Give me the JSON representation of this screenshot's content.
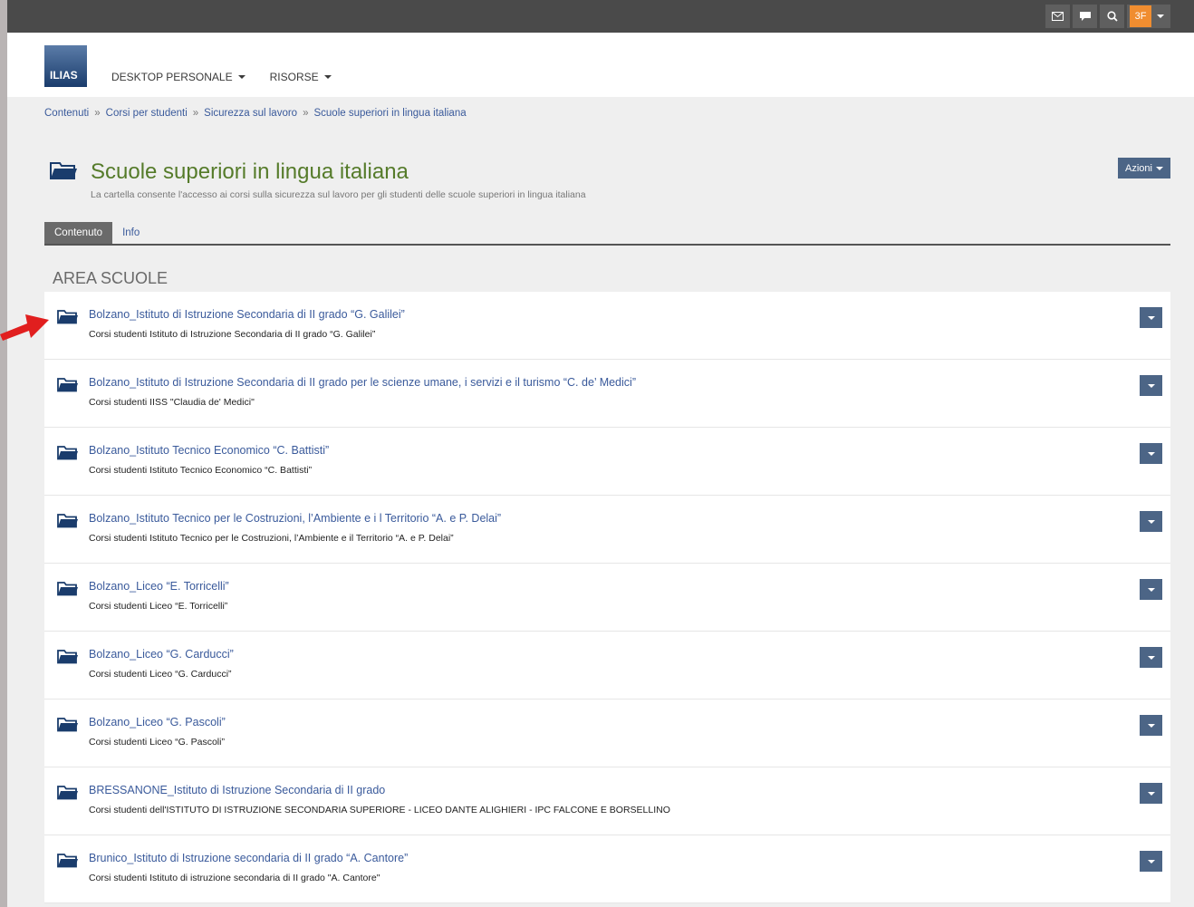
{
  "topbar": {
    "user_initials": "3F"
  },
  "header": {
    "logo_text": "ILIAS",
    "menu": [
      {
        "label": "DESKTOP PERSONALE"
      },
      {
        "label": "RISORSE"
      }
    ]
  },
  "breadcrumb": [
    "Contenuti",
    "Corsi per studenti",
    "Sicurezza sul lavoro",
    "Scuole superiori in lingua italiana"
  ],
  "breadcrumb_sep": "»",
  "page": {
    "title": "Scuole superiori in lingua italiana",
    "subtitle": "La cartella consente l'accesso ai corsi sulla sicurezza sul lavoro per gli studenti delle scuole superiori in lingua italiana",
    "actions_label": "Azioni"
  },
  "tabs": [
    {
      "label": "Contenuto",
      "active": true
    },
    {
      "label": "Info",
      "active": false
    }
  ],
  "section_title": "AREA SCUOLE",
  "items": [
    {
      "title": "Bolzano_Istituto di Istruzione Secondaria di II grado “G. Galilei”",
      "desc": "Corsi studenti Istituto di Istruzione Secondaria di II grado “G. Galilei”"
    },
    {
      "title": "Bolzano_Istituto di Istruzione Secondaria di II grado per le scienze umane, i servizi e il turismo “C. de’ Medici”",
      "desc": "Corsi studenti IISS \"Claudia de' Medici\""
    },
    {
      "title": "Bolzano_Istituto Tecnico Economico “C. Battisti”",
      "desc": "Corsi studenti Istituto Tecnico Economico “C. Battisti”"
    },
    {
      "title": "Bolzano_Istituto Tecnico per le Costruzioni, l’Ambiente e i l Territorio “A. e P. Delai”",
      "desc": "Corsi studenti Istituto Tecnico per le Costruzioni, l’Ambiente e il Territorio “A. e P. Delai”"
    },
    {
      "title": "Bolzano_Liceo “E. Torricelli”",
      "desc": "Corsi studenti Liceo “E. Torricelli”"
    },
    {
      "title": "Bolzano_Liceo “G. Carducci”",
      "desc": "Corsi studenti Liceo “G. Carducci”"
    },
    {
      "title": "Bolzano_Liceo “G. Pascoli”",
      "desc": "Corsi studenti Liceo “G. Pascoli”"
    },
    {
      "title": "BRESSANONE_Istituto di Istruzione Secondaria di II grado",
      "desc": "Corsi studenti dell'ISTITUTO DI ISTRUZIONE SECONDARIA SUPERIORE - LICEO DANTE ALIGHIERI - IPC FALCONE E BORSELLINO"
    },
    {
      "title": "Brunico_Istituto di Istruzione secondaria di II grado “A. Cantore”",
      "desc": "Corsi studenti Istituto di istruzione secondaria di II grado \"A. Cantore\""
    }
  ],
  "colors": {
    "accent": "#4c6586",
    "title_green": "#557b2a",
    "link_blue": "#3a5a9b",
    "user_orange": "#f08d30",
    "arrow_red": "#e11f1f"
  }
}
